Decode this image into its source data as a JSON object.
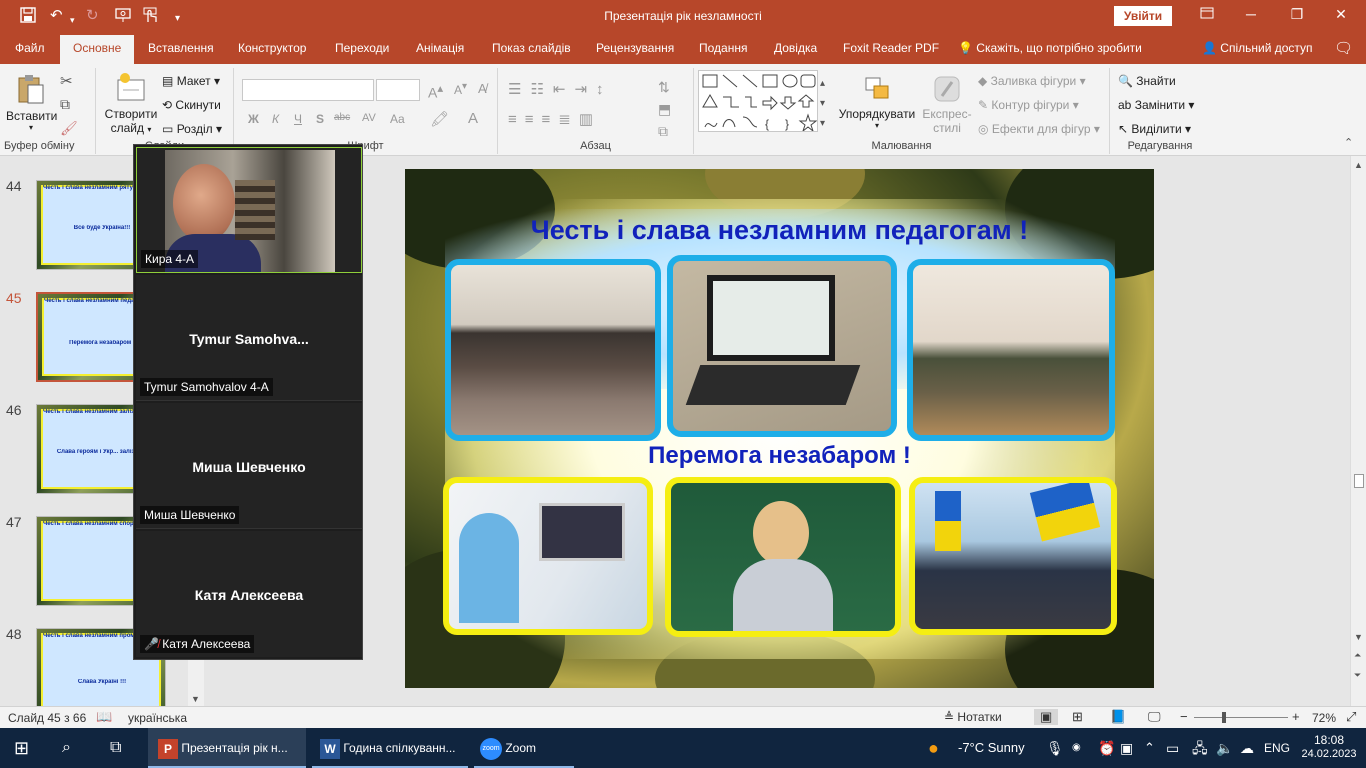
{
  "window": {
    "title": "Презентація рік незламності",
    "signin": "Увійти"
  },
  "tabs": [
    "Файл",
    "Основне",
    "Вставлення",
    "Конструктор",
    "Переходи",
    "Анімація",
    "Показ слайдів",
    "Рецензування",
    "Подання",
    "Довідка",
    "Foxit Reader PDF"
  ],
  "tellme": "Скажіть, що потрібно зробити",
  "share": "Спільний доступ",
  "ribbon": {
    "clipboard": {
      "paste": "Вставити",
      "label": "Буфер обміну"
    },
    "slides": {
      "new_slide": "Створити",
      "new_slide2": "слайд",
      "layout": "Макет",
      "reset": "Скинути",
      "section": "Розділ",
      "label": "Слайди"
    },
    "font": {
      "label": "Шрифт",
      "bold": "Ж",
      "italic": "К",
      "underline": "Ч",
      "strike": "S",
      "abc": "abc",
      "av": "AV",
      "aa": "Aa"
    },
    "paragraph": {
      "label": "Абзац"
    },
    "drawing": {
      "arrange": "Упорядкувати",
      "quickstyles": "Експрес-",
      "quickstyles2": "стилі",
      "fill": "Заливка фігури",
      "outline": "Контур фігури",
      "effects": "Ефекти для фігур",
      "label": "Малювання"
    },
    "editing": {
      "find": "Знайти",
      "replace": "Замінити",
      "select": "Виділити",
      "label": "Редагування"
    }
  },
  "thumbs": [
    {
      "num": "44",
      "caption": "Честь і слава незламним рятувальникам!",
      "sub": "Все буде Україна!!!"
    },
    {
      "num": "45",
      "caption": "Честь і слава незламним педагогам!",
      "sub": "Перемога незабаром !"
    },
    {
      "num": "46",
      "caption": "Честь і слава незламним залізничникам",
      "sub": "Слава героям і Укр... залізниці"
    },
    {
      "num": "47",
      "caption": "Честь і слава незламним спортсменам",
      "sub": ""
    },
    {
      "num": "48",
      "caption": "Честь і слава незламним промисловцям та аграріям!",
      "sub": "Слава Україні !!!"
    }
  ],
  "zoom": {
    "participants": [
      {
        "name": "Кира 4-А",
        "display": "",
        "video": true
      },
      {
        "name": "Tymur Samohvalov 4-A",
        "display": "Tymur  Samohva...",
        "video": false
      },
      {
        "name": "Миша Шевченко",
        "display": "Миша Шевченко",
        "video": false
      },
      {
        "name": "Катя Алексеева",
        "display": "Катя Алексеева",
        "video": false,
        "muted": true
      }
    ]
  },
  "slide": {
    "title": "Честь і слава незламним  педагогам !",
    "subtitle": "Перемога незабаром !"
  },
  "status": {
    "slide": "Слайд 45 з 66",
    "language": "українська",
    "notes": "Нотатки",
    "zoom": "72%"
  },
  "taskbar": {
    "apps": [
      "Презентація рік н...",
      "Година спілкуванн...",
      "Zoom"
    ],
    "weather": "-7°C  Sunny",
    "lang": "ENG",
    "time": "18:08",
    "date": "24.02.2023"
  }
}
